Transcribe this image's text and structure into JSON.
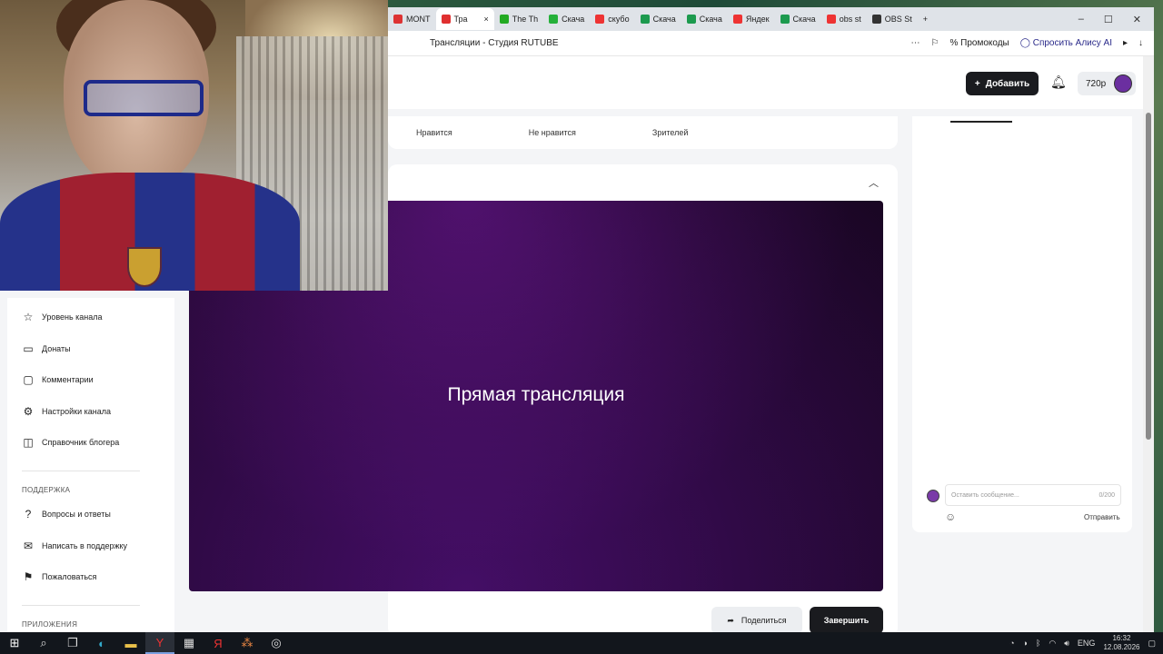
{
  "browser": {
    "tabs": [
      {
        "label": "MONT",
        "color": "#d33"
      },
      {
        "label": "Тра",
        "color": "#e03030",
        "active": true,
        "close": "×"
      },
      {
        "label": "The Th",
        "color": "#2a2"
      },
      {
        "label": "Скача",
        "color": "#25b03a"
      },
      {
        "label": "скубо",
        "color": "#e33"
      },
      {
        "label": "Скача",
        "color": "#1c9a4e"
      },
      {
        "label": "Скача",
        "color": "#1c9a4e"
      },
      {
        "label": "Яндек",
        "color": "#e33"
      },
      {
        "label": "Скача",
        "color": "#1c9a4e"
      },
      {
        "label": "obs st",
        "color": "#e33"
      },
      {
        "label": "OBS St",
        "color": "#333"
      }
    ],
    "new_tab": "+",
    "page_title": "Трансляции - Студия RUTUBE",
    "promo_label": "Промокоды",
    "alice_label": "Спросить Алису AI"
  },
  "header": {
    "add_label": "Добавить",
    "resolution": "720р"
  },
  "stats": {
    "likes": "Нравится",
    "dislikes": "Не нравится",
    "viewers": "Зрителей"
  },
  "sidebar": {
    "items": [
      {
        "label": "Уровень канала",
        "icon": "star-icon"
      },
      {
        "label": "Донаты",
        "icon": "wallet-icon"
      },
      {
        "label": "Комментарии",
        "icon": "comment-icon"
      },
      {
        "label": "Настройки канала",
        "icon": "gear-icon"
      },
      {
        "label": "Справочник блогера",
        "icon": "book-icon"
      }
    ],
    "support_header": "ПОДДЕРЖКА",
    "support_items": [
      {
        "label": "Вопросы и ответы",
        "icon": "question-icon"
      },
      {
        "label": "Написать в поддержку",
        "icon": "mail-icon"
      },
      {
        "label": "Пожаловаться",
        "icon": "flag-icon"
      }
    ],
    "apps_header": "ПРИЛОЖЕНИЯ"
  },
  "player": {
    "title": "Прямая трансляция"
  },
  "chat": {
    "placeholder": "Оставить сообщение...",
    "counter": "0/200",
    "send_label": "Отправить"
  },
  "actions": {
    "share_label": "Поделиться",
    "end_label": "Завершить"
  },
  "taskbar": {
    "lang": "ENG",
    "time": "16:32",
    "date": "12.08.2026"
  }
}
